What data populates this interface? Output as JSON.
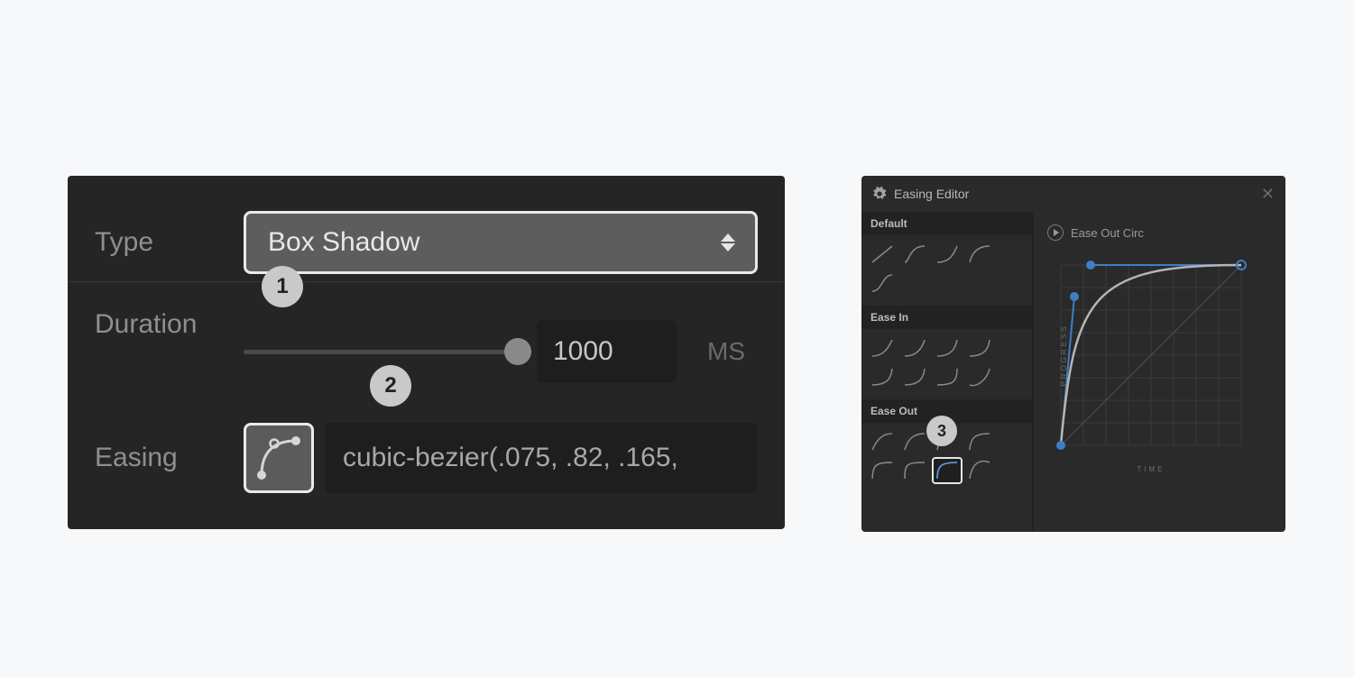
{
  "left_panel": {
    "type_label": "Type",
    "type_value": "Box Shadow",
    "duration_label": "Duration",
    "duration_value": "1000",
    "duration_unit": "MS",
    "easing_label": "Easing",
    "easing_value": "cubic-bezier(.075, .82, .165,"
  },
  "badges": {
    "b1": "1",
    "b2": "2",
    "b3": "3"
  },
  "right_panel": {
    "title": "Easing Editor",
    "curve_name": "Ease Out Circ",
    "progress_label": "PROGRESS",
    "time_label": "TIME",
    "sections": {
      "default": "Default",
      "ease_in": "Ease In",
      "ease_out": "Ease Out"
    }
  },
  "colors": {
    "accent_blue": "#3e7ec4",
    "curve_gray": "#b5b5b5"
  }
}
